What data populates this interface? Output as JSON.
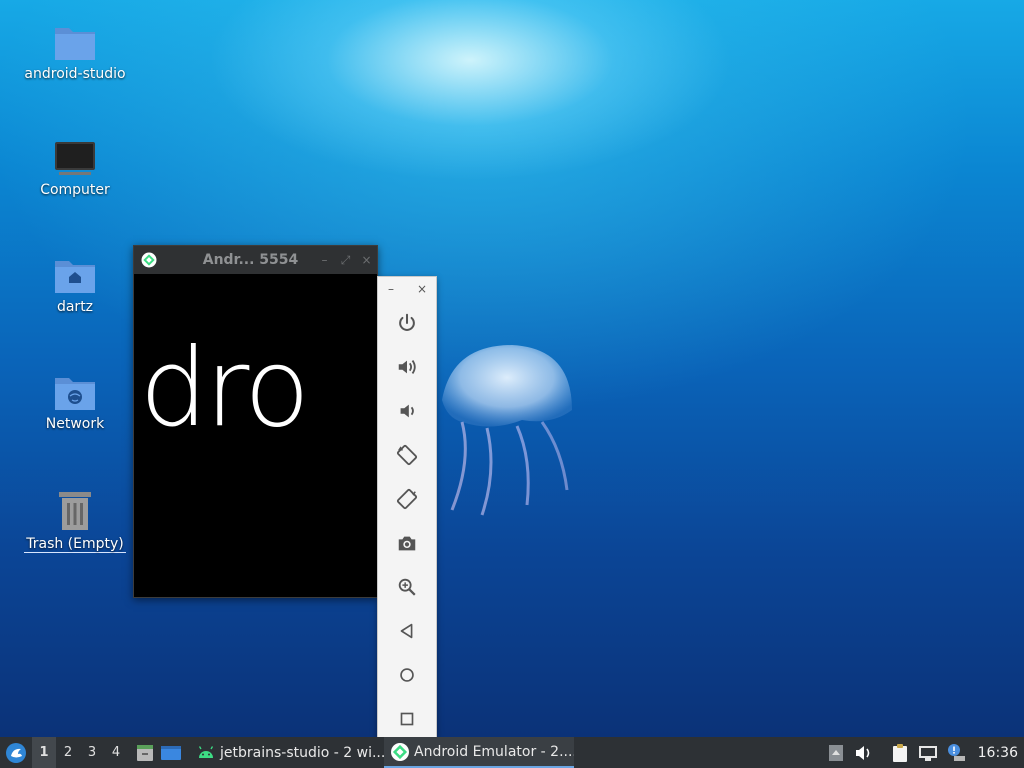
{
  "desktop": {
    "icons": [
      {
        "label": "android-studio",
        "icon": "folder-icon"
      },
      {
        "label": "Computer",
        "icon": "computer-icon"
      },
      {
        "label": "dartz",
        "icon": "home-folder-icon"
      },
      {
        "label": "Network",
        "icon": "network-folder-icon"
      },
      {
        "label": "Trash (Empty)",
        "icon": "trash-icon"
      }
    ]
  },
  "emulator_window": {
    "title": "Andr... 5554",
    "minimize": "–",
    "maximize": "⤢",
    "close": "×",
    "screen_text": "ndro"
  },
  "emulator_toolbar": {
    "minimize": "–",
    "close": "×",
    "buttons": [
      "power-icon",
      "volume-up-icon",
      "volume-down-icon",
      "rotate-left-icon",
      "rotate-right-icon",
      "camera-icon",
      "zoom-icon",
      "back-icon",
      "home-icon",
      "overview-icon"
    ]
  },
  "taskbar": {
    "workspaces": [
      "1",
      "2",
      "3",
      "4"
    ],
    "active_workspace": "1",
    "tasks": [
      {
        "label": "jetbrains-studio - 2 wi...",
        "icon": "android-icon"
      },
      {
        "label": "Android Emulator - 2....",
        "icon": "emulator-icon"
      }
    ],
    "clock": "16:36"
  }
}
